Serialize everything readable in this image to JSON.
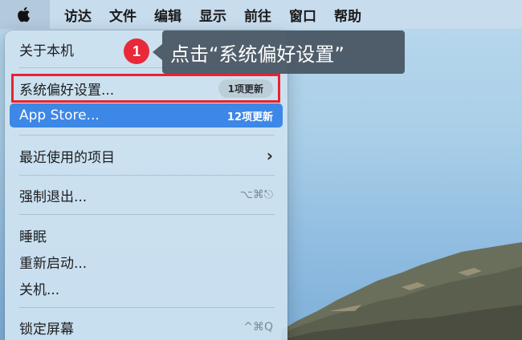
{
  "menubar": {
    "apple_icon": "apple-logo-icon",
    "items": [
      "访达",
      "文件",
      "编辑",
      "显示",
      "前往",
      "窗口",
      "帮助"
    ]
  },
  "menu": {
    "about": "关于本机",
    "system_prefs": {
      "label": "系统偏好设置...",
      "badge": "1项更新"
    },
    "app_store": {
      "label": "App Store...",
      "badge": "12项更新"
    },
    "recent_items": {
      "label": "最近使用的项目",
      "arrow": "›"
    },
    "force_quit": {
      "label": "强制退出...",
      "shortcut": "⌥⌘⎋"
    },
    "sleep": "睡眠",
    "restart": "重新启动...",
    "shutdown": "关机...",
    "lock_screen": {
      "label": "锁定屏幕",
      "shortcut": "^⌘Q"
    }
  },
  "callout": {
    "step": "1",
    "text": "点击“系统偏好设置”"
  },
  "colors": {
    "highlight_border": "#e8232f",
    "selected_row": "#3d87e6",
    "step_circle": "#e8293a",
    "callout_bg": "#465260"
  }
}
